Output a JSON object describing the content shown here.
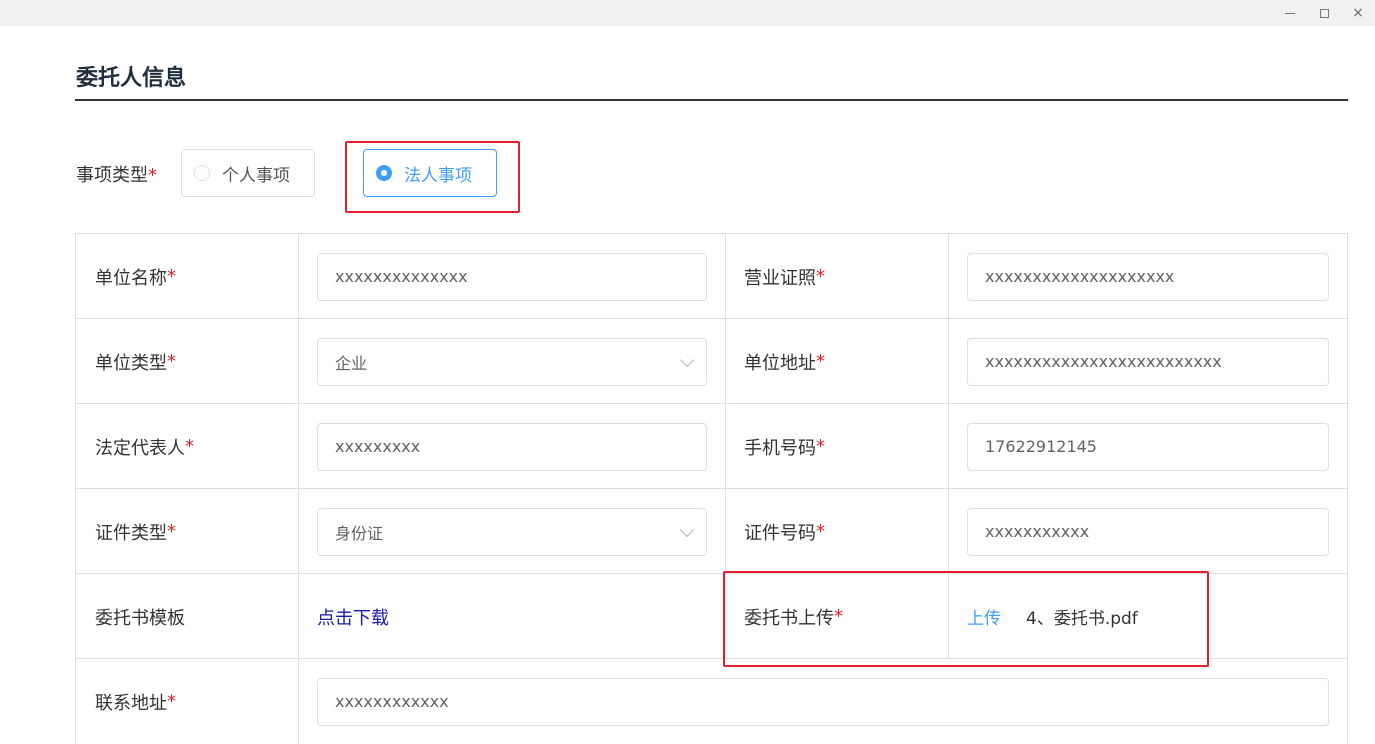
{
  "window": {
    "controls": [
      "minimize-icon",
      "maximize-icon",
      "close-icon"
    ],
    "close_glyph": "×"
  },
  "section": {
    "title": "委托人信息"
  },
  "matter_type": {
    "label": "事项类型",
    "required": "*",
    "options": [
      "个人事项",
      "法人事项"
    ],
    "selected": "法人事项"
  },
  "form": {
    "rows": [
      {
        "label_left": "单位名称",
        "value_left": "xxxxxxxxxxxxxx",
        "label_right": "营业证照",
        "value_right": "xxxxxxxxxxxxxxxxxxxx"
      },
      {
        "label_left": "单位类型",
        "value_left": "企业",
        "label_right": "单位地址",
        "value_right": "xxxxxxxxxxxxxxxxxxxxxxxxx"
      },
      {
        "label_left": "法定代表人",
        "value_left": "xxxxxxxxx",
        "label_right": "手机号码",
        "value_right": "17622912145"
      },
      {
        "label_left": "证件类型",
        "value_left": "身份证",
        "label_right": "证件号码",
        "value_right": "xxxxxxxxxxx"
      },
      {
        "label_left": "委托书模板",
        "value_left": "点击下载",
        "label_right": "委托书上传",
        "upload_label": "上传",
        "file_name": "4、委托书.pdf"
      },
      {
        "label_left": "联系地址",
        "value_left": "xxxxxxxxxxxx"
      }
    ],
    "required_mark": "*"
  },
  "colors": {
    "accent": "#409eff",
    "required": "#e0202b",
    "highlight": "#e0202b",
    "link": "#1a1aa6"
  }
}
